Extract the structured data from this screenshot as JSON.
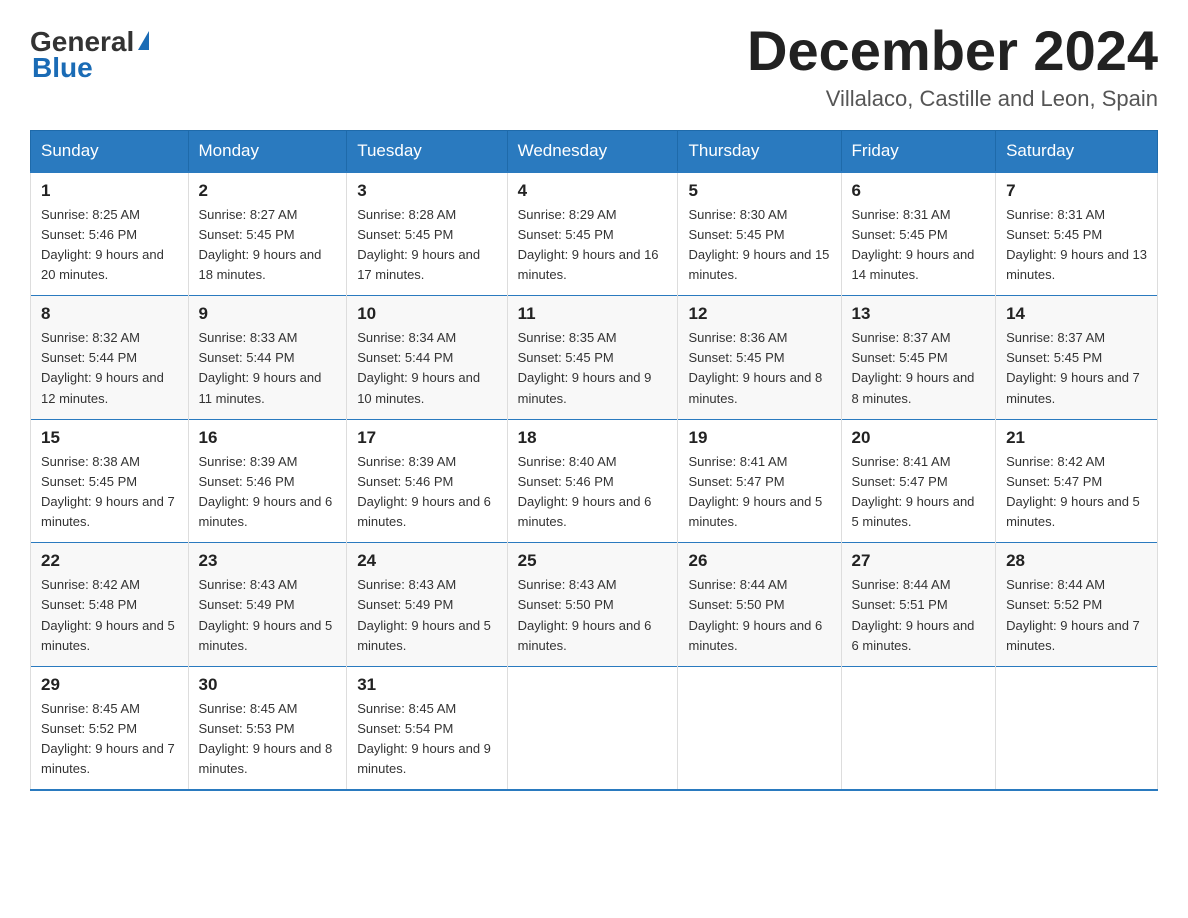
{
  "header": {
    "logo_general": "General",
    "logo_blue": "Blue",
    "month_title": "December 2024",
    "location": "Villalaco, Castille and Leon, Spain"
  },
  "weekdays": [
    "Sunday",
    "Monday",
    "Tuesday",
    "Wednesday",
    "Thursday",
    "Friday",
    "Saturday"
  ],
  "weeks": [
    [
      {
        "day": "1",
        "sunrise": "8:25 AM",
        "sunset": "5:46 PM",
        "daylight": "9 hours and 20 minutes."
      },
      {
        "day": "2",
        "sunrise": "8:27 AM",
        "sunset": "5:45 PM",
        "daylight": "9 hours and 18 minutes."
      },
      {
        "day": "3",
        "sunrise": "8:28 AM",
        "sunset": "5:45 PM",
        "daylight": "9 hours and 17 minutes."
      },
      {
        "day": "4",
        "sunrise": "8:29 AM",
        "sunset": "5:45 PM",
        "daylight": "9 hours and 16 minutes."
      },
      {
        "day": "5",
        "sunrise": "8:30 AM",
        "sunset": "5:45 PM",
        "daylight": "9 hours and 15 minutes."
      },
      {
        "day": "6",
        "sunrise": "8:31 AM",
        "sunset": "5:45 PM",
        "daylight": "9 hours and 14 minutes."
      },
      {
        "day": "7",
        "sunrise": "8:31 AM",
        "sunset": "5:45 PM",
        "daylight": "9 hours and 13 minutes."
      }
    ],
    [
      {
        "day": "8",
        "sunrise": "8:32 AM",
        "sunset": "5:44 PM",
        "daylight": "9 hours and 12 minutes."
      },
      {
        "day": "9",
        "sunrise": "8:33 AM",
        "sunset": "5:44 PM",
        "daylight": "9 hours and 11 minutes."
      },
      {
        "day": "10",
        "sunrise": "8:34 AM",
        "sunset": "5:44 PM",
        "daylight": "9 hours and 10 minutes."
      },
      {
        "day": "11",
        "sunrise": "8:35 AM",
        "sunset": "5:45 PM",
        "daylight": "9 hours and 9 minutes."
      },
      {
        "day": "12",
        "sunrise": "8:36 AM",
        "sunset": "5:45 PM",
        "daylight": "9 hours and 8 minutes."
      },
      {
        "day": "13",
        "sunrise": "8:37 AM",
        "sunset": "5:45 PM",
        "daylight": "9 hours and 8 minutes."
      },
      {
        "day": "14",
        "sunrise": "8:37 AM",
        "sunset": "5:45 PM",
        "daylight": "9 hours and 7 minutes."
      }
    ],
    [
      {
        "day": "15",
        "sunrise": "8:38 AM",
        "sunset": "5:45 PM",
        "daylight": "9 hours and 7 minutes."
      },
      {
        "day": "16",
        "sunrise": "8:39 AM",
        "sunset": "5:46 PM",
        "daylight": "9 hours and 6 minutes."
      },
      {
        "day": "17",
        "sunrise": "8:39 AM",
        "sunset": "5:46 PM",
        "daylight": "9 hours and 6 minutes."
      },
      {
        "day": "18",
        "sunrise": "8:40 AM",
        "sunset": "5:46 PM",
        "daylight": "9 hours and 6 minutes."
      },
      {
        "day": "19",
        "sunrise": "8:41 AM",
        "sunset": "5:47 PM",
        "daylight": "9 hours and 5 minutes."
      },
      {
        "day": "20",
        "sunrise": "8:41 AM",
        "sunset": "5:47 PM",
        "daylight": "9 hours and 5 minutes."
      },
      {
        "day": "21",
        "sunrise": "8:42 AM",
        "sunset": "5:47 PM",
        "daylight": "9 hours and 5 minutes."
      }
    ],
    [
      {
        "day": "22",
        "sunrise": "8:42 AM",
        "sunset": "5:48 PM",
        "daylight": "9 hours and 5 minutes."
      },
      {
        "day": "23",
        "sunrise": "8:43 AM",
        "sunset": "5:49 PM",
        "daylight": "9 hours and 5 minutes."
      },
      {
        "day": "24",
        "sunrise": "8:43 AM",
        "sunset": "5:49 PM",
        "daylight": "9 hours and 5 minutes."
      },
      {
        "day": "25",
        "sunrise": "8:43 AM",
        "sunset": "5:50 PM",
        "daylight": "9 hours and 6 minutes."
      },
      {
        "day": "26",
        "sunrise": "8:44 AM",
        "sunset": "5:50 PM",
        "daylight": "9 hours and 6 minutes."
      },
      {
        "day": "27",
        "sunrise": "8:44 AM",
        "sunset": "5:51 PM",
        "daylight": "9 hours and 6 minutes."
      },
      {
        "day": "28",
        "sunrise": "8:44 AM",
        "sunset": "5:52 PM",
        "daylight": "9 hours and 7 minutes."
      }
    ],
    [
      {
        "day": "29",
        "sunrise": "8:45 AM",
        "sunset": "5:52 PM",
        "daylight": "9 hours and 7 minutes."
      },
      {
        "day": "30",
        "sunrise": "8:45 AM",
        "sunset": "5:53 PM",
        "daylight": "9 hours and 8 minutes."
      },
      {
        "day": "31",
        "sunrise": "8:45 AM",
        "sunset": "5:54 PM",
        "daylight": "9 hours and 9 minutes."
      },
      null,
      null,
      null,
      null
    ]
  ]
}
